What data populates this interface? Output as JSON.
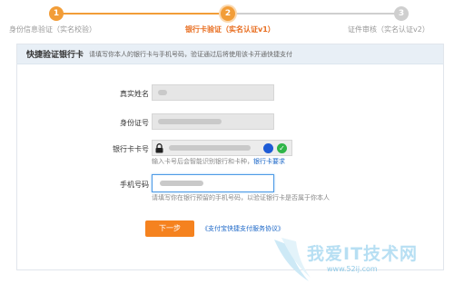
{
  "steps": [
    {
      "number": "1",
      "label": "身份信息验证（实名校验）",
      "state": "done"
    },
    {
      "number": "2",
      "label": "银行卡验证（实名认证v1）",
      "state": "current"
    },
    {
      "number": "3",
      "label": "证件审核（实名认证v2）",
      "state": "pending"
    }
  ],
  "colors": {
    "accent": "#f29d38",
    "link": "#1a66c7",
    "button": "#f5821f"
  },
  "panel": {
    "title": "快捷验证银行卡",
    "description": "请填写你本人的银行卡与手机号码，验证通过后将使用该卡开通快捷支付"
  },
  "form": {
    "name_label": "真实姓名",
    "id_label": "身份证号",
    "card_label": "银行卡卡号",
    "card_hint": "输入卡号后会智能识别银行和卡种，",
    "card_hint_link": "银行卡要求",
    "phone_label": "手机号码",
    "phone_hint": "请填写你在银行预留的手机号码，以验证银行卡是否属于你本人",
    "next_button": "下一步",
    "agreement_link": "《支付宝快捷支付服务协议》"
  },
  "watermark": {
    "text": "我爱IT技术网",
    "url": "www.52ij.com"
  }
}
